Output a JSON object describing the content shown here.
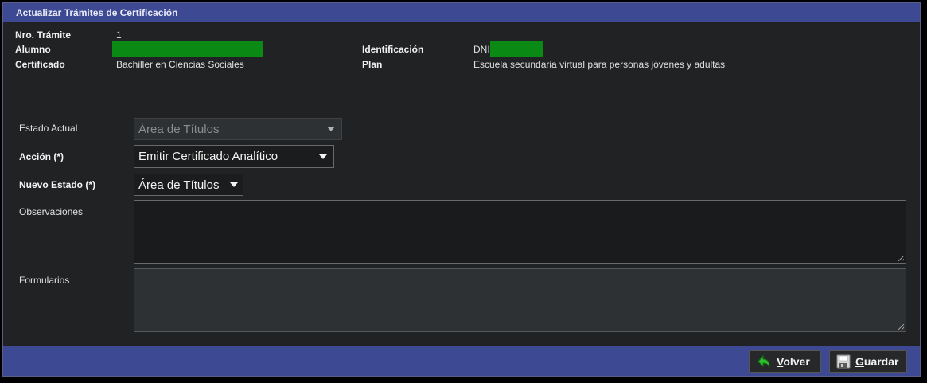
{
  "window": {
    "title": "Actualizar Trámites de Certificación"
  },
  "info": {
    "tramite_label": "Nro. Trámite",
    "tramite_value": "1",
    "alumno_label": "Alumno",
    "identificacion_label": "Identificación",
    "identificacion_prefix": "DNI",
    "certificado_label": "Certificado",
    "certificado_value": "Bachiller en Ciencias Sociales",
    "plan_label": "Plan",
    "plan_value": "Escuela secundaria virtual para personas jóvenes y adultas"
  },
  "form": {
    "estado_actual_label": "Estado Actual",
    "estado_actual_value": "Área de Títulos",
    "accion_label": "Acción (*)",
    "accion_value": "Emitir Certificado Analítico",
    "nuevo_estado_label": "Nuevo Estado (*)",
    "nuevo_estado_value": "Área de Títulos",
    "observaciones_label": "Observaciones",
    "formularios_label": "Formularios"
  },
  "footer": {
    "volver_first": "V",
    "volver_rest": "olver",
    "guardar_first": "G",
    "guardar_rest": "uardar"
  },
  "colors": {
    "header_bg": "#3d4a93",
    "redaction": "#0a8a14",
    "panel_bg": "#202223"
  },
  "icons": {
    "volver": "green-return-arrow-icon",
    "guardar": "floppy-disk-icon",
    "dropdown": "caret-down-icon"
  }
}
